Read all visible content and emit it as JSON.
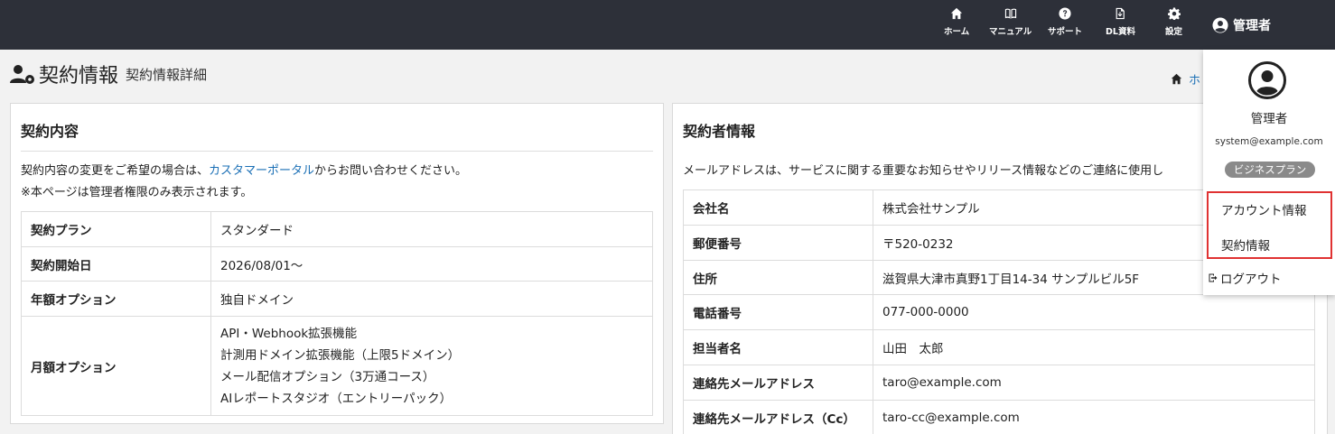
{
  "nav": {
    "home": "ホーム",
    "manual": "マニュアル",
    "support": "サポート",
    "dl": "DL資料",
    "settings": "設定",
    "user": "管理者"
  },
  "page": {
    "title": "契約情報",
    "subtitle": "契約情報詳細",
    "breadcrumb": "ホ"
  },
  "contract": {
    "heading": "契約内容",
    "note_prefix": "契約内容の変更をご希望の場合は、",
    "note_link": "カスタマーポータル",
    "note_suffix": "からお問い合わせください。",
    "note2": "※本ページは管理者権限のみ表示されます。",
    "rows": [
      {
        "key": "契約プラン",
        "value": "スタンダード"
      },
      {
        "key": "契約開始日",
        "value": "2026/08/01～"
      },
      {
        "key": "年額オプション",
        "value": "独自ドメイン"
      }
    ],
    "monthly_key": "月額オプション",
    "monthly_values": [
      "API・Webhook拡張機能",
      "計測用ドメイン拡張機能（上限5ドメイン）",
      "メール配信オプション（3万通コース）",
      "AIレポートスタジオ（エントリーパック）"
    ]
  },
  "contractor": {
    "heading": "契約者情報",
    "note": "メールアドレスは、サービスに関する重要なお知らせやリリース情報などのご連絡に使用し",
    "rows": [
      {
        "key": "会社名",
        "value": "株式会社サンプル"
      },
      {
        "key": "郵便番号",
        "value": "〒520-0232"
      },
      {
        "key": "住所",
        "value": "滋賀県大津市真野1丁目14-34 サンプルビル5F"
      },
      {
        "key": "電話番号",
        "value": "077-000-0000"
      },
      {
        "key": "担当者名",
        "value": "山田　太郎"
      },
      {
        "key": "連絡先メールアドレス",
        "value": "taro@example.com"
      },
      {
        "key": "連絡先メールアドレス（Cc）",
        "value": "taro-cc@example.com"
      }
    ]
  },
  "dropdown": {
    "name": "管理者",
    "email": "system@example.com",
    "plan_badge": "ビジネスプラン",
    "account_info": "アカウント情報",
    "contract_info": "契約情報",
    "logout": "ログアウト"
  }
}
